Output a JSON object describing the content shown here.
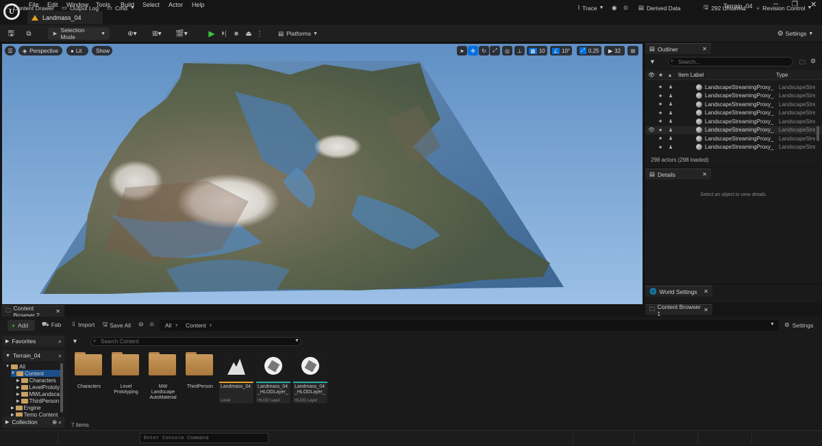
{
  "app": {
    "logo": "unreal-logo",
    "project_name": "Terrain_04"
  },
  "menu": [
    "File",
    "Edit",
    "Window",
    "Tools",
    "Build",
    "Select",
    "Actor",
    "Help"
  ],
  "level_tab": "Landmass_04",
  "window_controls": [
    "minimize",
    "restore",
    "close"
  ],
  "toolbar": {
    "selection_mode": "Selection Mode",
    "platforms": "Platforms",
    "settings": "Settings"
  },
  "viewport": {
    "perspective": "Perspective",
    "lit": "Lit",
    "show": "Show",
    "grid_snap": "10",
    "rotation_snap": "10°",
    "scale_snap": "0.25",
    "camera_speed": "32"
  },
  "outliner": {
    "tab": "Outliner",
    "search_placeholder": "Search...",
    "col_label": "Item Label",
    "col_type": "Type",
    "rows": [
      {
        "label": "LandscapeStreamingProxy_",
        "type": "LandscapeStre",
        "eye": false
      },
      {
        "label": "LandscapeStreamingProxy_",
        "type": "LandscapeStre",
        "eye": false
      },
      {
        "label": "LandscapeStreamingProxy_",
        "type": "LandscapeStre",
        "eye": false
      },
      {
        "label": "LandscapeStreamingProxy_",
        "type": "LandscapeStre",
        "eye": false
      },
      {
        "label": "LandscapeStreamingProxy_",
        "type": "LandscapeStre",
        "eye": false
      },
      {
        "label": "LandscapeStreamingProxy_",
        "type": "LandscapeStre",
        "eye": true
      },
      {
        "label": "LandscapeStreamingProxy_",
        "type": "LandscapeStre",
        "eye": false
      },
      {
        "label": "LandscapeStreamingProxy_",
        "type": "LandscapeStre",
        "eye": false
      }
    ],
    "status": "298 actors (298 loaded)"
  },
  "details": {
    "tab": "Details",
    "empty_msg": "Select an object to view details."
  },
  "world_settings": {
    "tab": "World Settings"
  },
  "content_browser_1": {
    "tab": "Content Browser 1"
  },
  "content_browser": {
    "tab": "Content Browser 2",
    "add": "Add",
    "fab": "Fab",
    "import": "Import",
    "save_all": "Save All",
    "path": [
      "All",
      "Content"
    ],
    "settings": "Settings",
    "favorites": "Favorites",
    "project": "Terrain_04",
    "search_placeholder": "Search Content",
    "collection": "Collection",
    "tree": [
      {
        "label": "All",
        "level": 0
      },
      {
        "label": "Content",
        "level": 1,
        "selected": true
      },
      {
        "label": "Characters",
        "level": 2
      },
      {
        "label": "LevelPrototy",
        "level": 2
      },
      {
        "label": "MWLandsca",
        "level": 2
      },
      {
        "label": "ThirdPerson",
        "level": 2
      },
      {
        "label": "Engine",
        "level": 1
      },
      {
        "label": "Temp Content",
        "level": 1
      }
    ],
    "assets": [
      {
        "name": "Characters",
        "kind": "folder"
      },
      {
        "name": "Level Prototyping",
        "kind": "folder"
      },
      {
        "name": "MW Landscape AutoMaterial",
        "kind": "folder"
      },
      {
        "name": "ThirdPerson",
        "kind": "folder"
      },
      {
        "name": "Landmass_04",
        "kind": "level",
        "sub": "Level"
      },
      {
        "name": "Landmass_04 _HLODLayer_",
        "kind": "hlod",
        "sub": "HLOD Layer"
      },
      {
        "name": "Landmass_04 _HLODLayer_",
        "kind": "hlod",
        "sub": "HLOD Layer"
      }
    ],
    "item_count": "7 items"
  },
  "statusbar": {
    "content_drawer": "Content Drawer",
    "output_log": "Output Log",
    "cmd": "Cmd",
    "console_placeholder": "Enter Console Command",
    "trace": "Trace",
    "derived_data": "Derived Data",
    "unsaved": "292 Unsaved",
    "revision_control": "Revision Control"
  },
  "colors": {
    "accent": "#0070e0",
    "play": "#3fc23f",
    "level_bar": "#e8a020",
    "hlod_bar": "#2ab0b0"
  }
}
